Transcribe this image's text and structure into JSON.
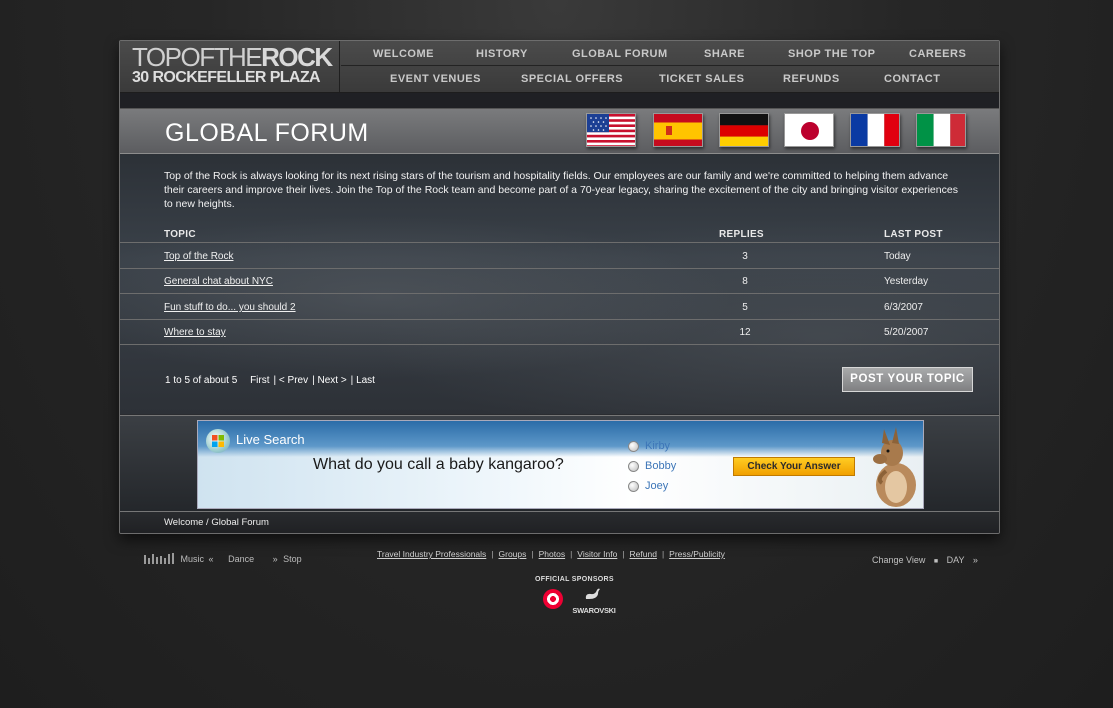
{
  "logo": {
    "line1_thin": "TOPOF",
    "line1_the": "THE",
    "line1_rock": "ROCK",
    "line2": "30 ROCKEFELLER PLAZA"
  },
  "nav": {
    "row1": [
      "WELCOME",
      "HISTORY",
      "GLOBAL FORUM",
      "SHARE",
      "SHOP THE TOP",
      "CAREERS"
    ],
    "row2": [
      "EVENT VENUES",
      "SPECIAL OFFERS",
      "TICKET SALES",
      "REFUNDS",
      "CONTACT"
    ]
  },
  "page_title": "GLOBAL FORUM",
  "flags": [
    "us-flag-icon",
    "spain-flag-icon",
    "germany-flag-icon",
    "japan-flag-icon",
    "france-flag-icon",
    "italy-flag-icon"
  ],
  "intro": "Top of the Rock is always looking for its next rising stars of the tourism and hospitality fields. Our employees are our family and we're committed to helping them advance their careers and improve their lives. Join the Top of the Rock team and become part of a 70-year legacy, sharing the excitement of the city and bringing visitor experiences to new heights.",
  "table": {
    "headers": {
      "topic": "TOPIC",
      "replies": "REPLIES",
      "last_post": "LAST POST"
    },
    "rows": [
      {
        "topic": "Top of the Rock",
        "replies": "3",
        "last_post": "Today"
      },
      {
        "topic": "General chat about NYC",
        "replies": "8",
        "last_post": "Yesterday"
      },
      {
        "topic": "Fun stuff to do... you should 2",
        "replies": "5",
        "last_post": "6/3/2007"
      },
      {
        "topic": "Where to stay",
        "replies": "12",
        "last_post": "5/20/2007"
      }
    ]
  },
  "pager": {
    "summary": "1 to 5 of about 5",
    "first": "First",
    "prev": "< Prev",
    "next": "Next >",
    "last": "Last"
  },
  "post_button": "POST YOUR TOPIC",
  "ad": {
    "brand": "Live Search",
    "question": "What do you call a baby kangaroo?",
    "options": [
      "Kirby",
      "Bobby",
      "Joey"
    ],
    "check_button": "Check Your Answer"
  },
  "breadcrumb": "Welcome / Global Forum",
  "footer": {
    "music": {
      "music": "Music",
      "dance": "Dance",
      "stop": "Stop"
    },
    "links": [
      "Travel Industry Professionals",
      "Groups",
      "Photos",
      "Visitor Info",
      "Refund",
      "Press/Publicity"
    ],
    "change_view": "Change View",
    "view_mode": "DAY",
    "sponsors_label": "OFFICIAL SPONSORS",
    "swarovski": "SWAROVSKI"
  },
  "colors": {
    "background": "#262626",
    "frame": "#2a2c30",
    "title_bar": "#6c6d6f",
    "ad_button": "#f7b500",
    "link": "#3d76b8"
  }
}
